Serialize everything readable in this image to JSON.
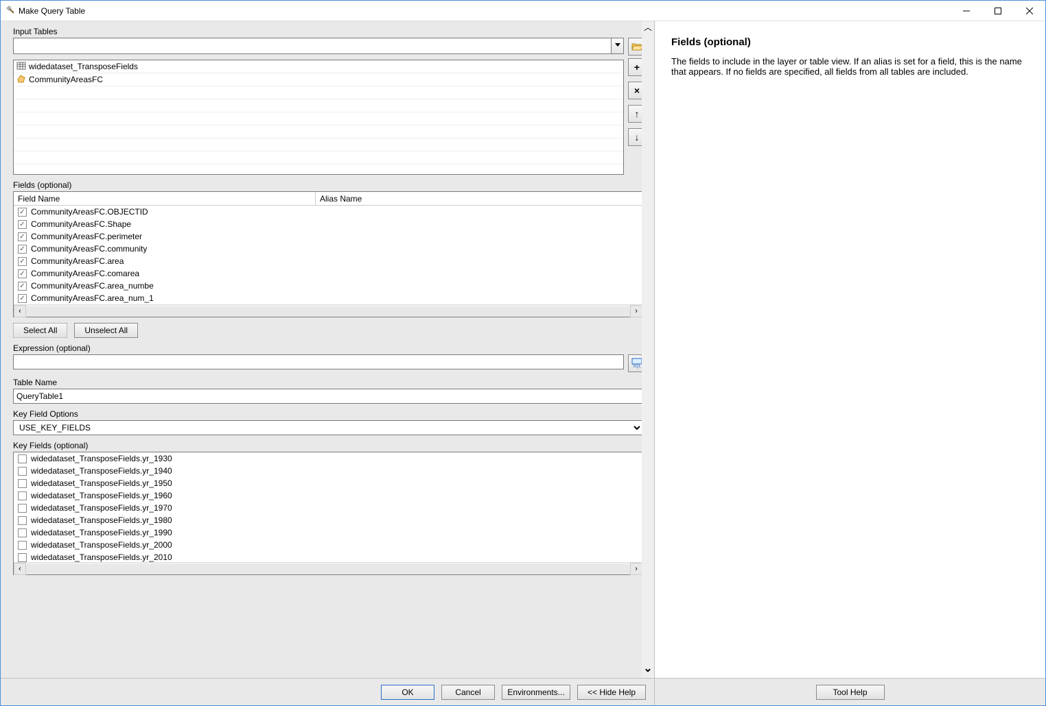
{
  "titlebar": {
    "title": "Make Query Table"
  },
  "input_tables": {
    "label": "Input Tables",
    "value": "",
    "items": [
      {
        "icon": "table",
        "name": "widedataset_TransposeFields"
      },
      {
        "icon": "polygon",
        "name": "CommunityAreasFC"
      }
    ]
  },
  "buttons": {
    "browse_tip": "Browse",
    "add": "+",
    "remove": "×",
    "up": "↑",
    "down": "↓"
  },
  "fields": {
    "label": "Fields (optional)",
    "col1": "Field Name",
    "col2": "Alias Name",
    "rows": [
      {
        "checked": true,
        "name": "CommunityAreasFC.OBJECTID",
        "alias": ""
      },
      {
        "checked": true,
        "name": "CommunityAreasFC.Shape",
        "alias": ""
      },
      {
        "checked": true,
        "name": "CommunityAreasFC.perimeter",
        "alias": ""
      },
      {
        "checked": true,
        "name": "CommunityAreasFC.community",
        "alias": ""
      },
      {
        "checked": true,
        "name": "CommunityAreasFC.area",
        "alias": ""
      },
      {
        "checked": true,
        "name": "CommunityAreasFC.comarea",
        "alias": ""
      },
      {
        "checked": true,
        "name": "CommunityAreasFC.area_numbe",
        "alias": ""
      },
      {
        "checked": true,
        "name": "CommunityAreasFC.area_num_1",
        "alias": ""
      }
    ],
    "select_all": "Select All",
    "unselect_all": "Unselect All"
  },
  "expression": {
    "label": "Expression (optional)",
    "value": "",
    "sql_tip": "SQL"
  },
  "table_name": {
    "label": "Table Name",
    "value": "QueryTable1"
  },
  "key_field_options": {
    "label": "Key Field Options",
    "value": "USE_KEY_FIELDS"
  },
  "key_fields": {
    "label": "Key Fields (optional)",
    "rows": [
      {
        "checked": false,
        "name": "widedataset_TransposeFields.yr_1930"
      },
      {
        "checked": false,
        "name": "widedataset_TransposeFields.yr_1940"
      },
      {
        "checked": false,
        "name": "widedataset_TransposeFields.yr_1950"
      },
      {
        "checked": false,
        "name": "widedataset_TransposeFields.yr_1960"
      },
      {
        "checked": false,
        "name": "widedataset_TransposeFields.yr_1970"
      },
      {
        "checked": false,
        "name": "widedataset_TransposeFields.yr_1980"
      },
      {
        "checked": false,
        "name": "widedataset_TransposeFields.yr_1990"
      },
      {
        "checked": false,
        "name": "widedataset_TransposeFields.yr_2000"
      },
      {
        "checked": false,
        "name": "widedataset_TransposeFields.yr_2010"
      }
    ]
  },
  "footer": {
    "ok": "OK",
    "cancel": "Cancel",
    "environments": "Environments...",
    "hide_help": "<< Hide Help",
    "tool_help": "Tool Help"
  },
  "help": {
    "title": "Fields (optional)",
    "text": "The fields to include in the layer or table view. If an alias is set for a field, this is the name that appears. If no fields are specified, all fields from all tables are included."
  }
}
